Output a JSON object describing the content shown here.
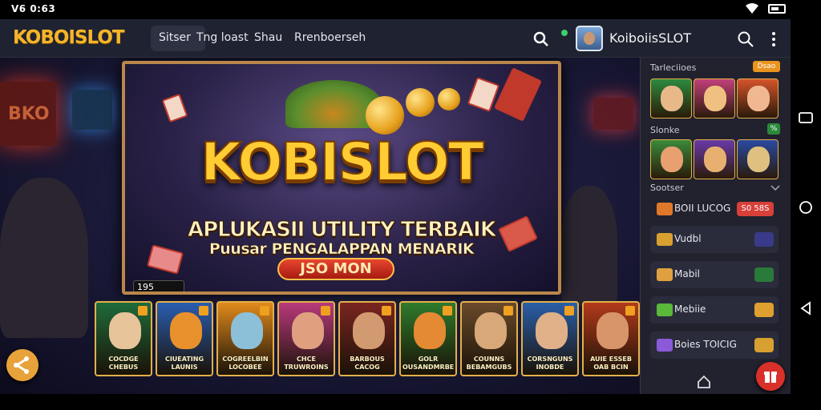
{
  "status_bar": {
    "time": "V6 0:63"
  },
  "app_bar": {
    "logo": "KOBOISLOT",
    "nav": [
      "Sitser",
      "Tng loast",
      "Shau",
      "Rrenboerseh"
    ],
    "username": "KoiboiisSLOT"
  },
  "banner": {
    "title": "KOBISLOT",
    "subtitle": "APLUKASII UTILITY TERBAIK",
    "tagline": "Puusar PENGALAPPAN MENARIK",
    "cta": "JSO MON",
    "counter": "195"
  },
  "game_tiles": [
    {
      "label": "COCDGE\nCHEBUS",
      "color": "#1f6b3a",
      "face": "#e8c49a"
    },
    {
      "label": "CIUEATING\nLAUNIS",
      "color": "#2a5db0",
      "face": "#e8912c"
    },
    {
      "label": "COGREELBIN\nLOCOBEE",
      "color": "#e08a1c",
      "face": "#8cc0d8"
    },
    {
      "label": "CHCE\nTRUWROINS",
      "color": "#b83a7c",
      "face": "#e0a080"
    },
    {
      "label": "BARBOUS\nCACOG",
      "color": "#7a2520",
      "face": "#d29a70"
    },
    {
      "label": "GOLR\nOUSANDMRBE",
      "color": "#2f7a2c",
      "face": "#e38a32"
    },
    {
      "label": "COUNNS\nBEBAMGUBS",
      "color": "#6a4a2a",
      "face": "#d8a878"
    },
    {
      "label": "CORSNGUNS\nINOBDE",
      "color": "#2a5ea8",
      "face": "#e0b088"
    },
    {
      "label": "AUIE ESSEB\nOAB BCIN",
      "color": "#b33a1a",
      "face": "#d8956a"
    }
  ],
  "sidebar": {
    "section1": {
      "title": "Tarleciioes",
      "badge": "Dsao"
    },
    "row1_thumbs": [
      {
        "color": "#2d8a3e",
        "face": "#e8b888"
      },
      {
        "color": "#c2407a",
        "face": "#f0c080"
      },
      {
        "color": "#d4542a",
        "face": "#f0b890"
      }
    ],
    "section2": {
      "title": "Slonke",
      "badge": "%"
    },
    "row2_thumbs": [
      {
        "color": "#3a8a3a",
        "face": "#e8a070"
      },
      {
        "color": "#6a3aa8",
        "face": "#e8b070"
      },
      {
        "color": "#2a4aa0",
        "face": "#e0c080"
      }
    ],
    "section3": {
      "title": "Sootser"
    },
    "rows": [
      {
        "label": "BOII LUCOG",
        "button": "S0 58S",
        "button_color": "#d8403a",
        "icon_color": "#e0782a",
        "boxed": false
      },
      {
        "label": "Vudbl",
        "button": "",
        "button_color": "#3a3a8a",
        "icon_color": "#d8a030",
        "boxed": true
      },
      {
        "label": "Mabil",
        "button": "",
        "button_color": "#2a7a3a",
        "icon_color": "#e0a040",
        "boxed": true
      },
      {
        "label": "Mebiie",
        "button": "",
        "button_color": "#e0a030",
        "icon_color": "#5ab83a",
        "boxed": true
      },
      {
        "label": "Boies  TOICIG",
        "button": "",
        "button_color": "#d8a030",
        "icon_color": "#8a5ad8",
        "boxed": true
      }
    ]
  }
}
